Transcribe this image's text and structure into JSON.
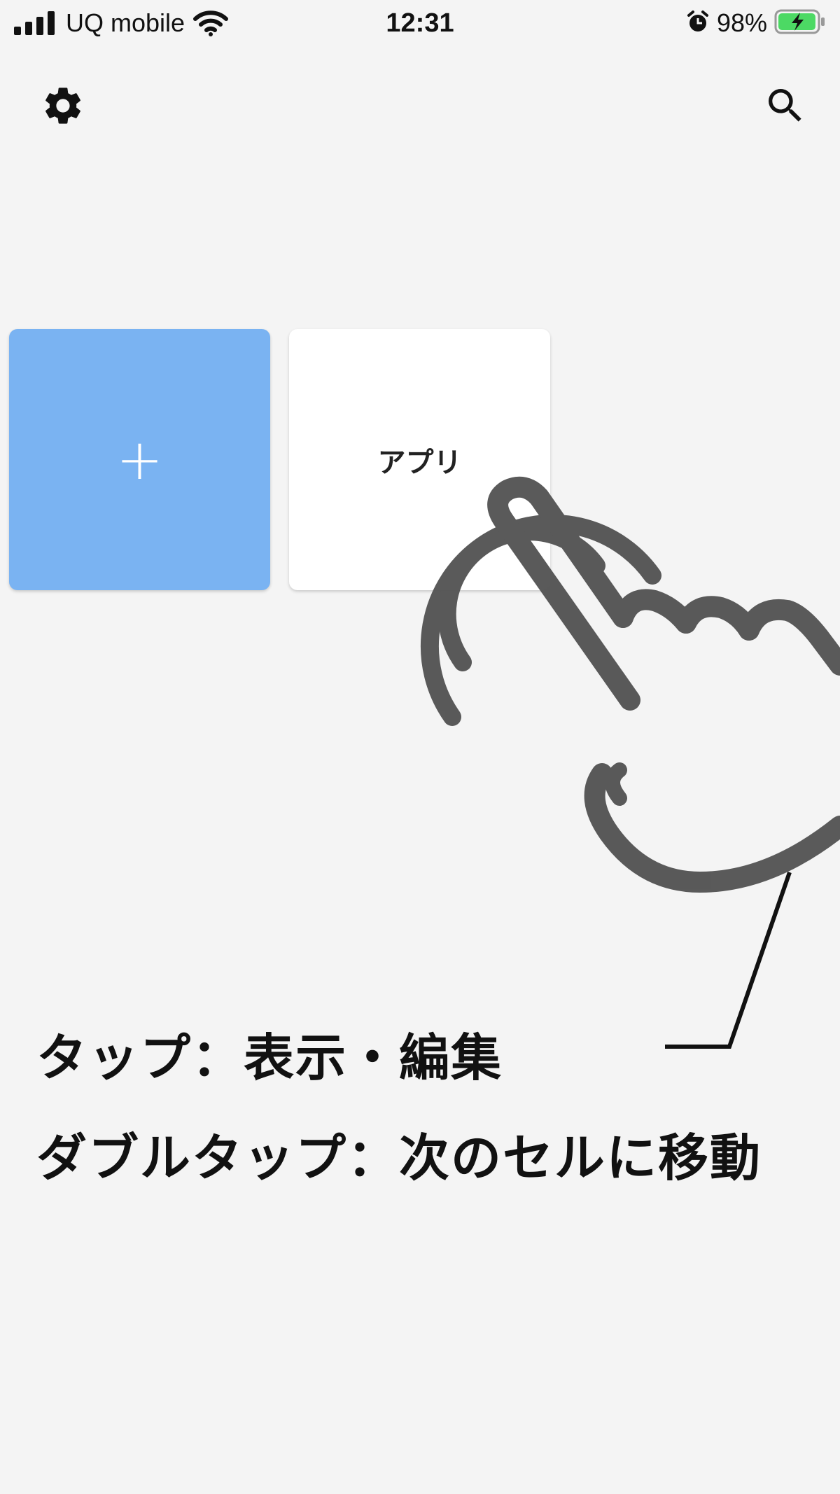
{
  "status_bar": {
    "carrier": "UQ mobile",
    "time": "12:31",
    "battery_percent": "98%",
    "battery_level": 0.98,
    "signal_bars": 4,
    "icons": [
      "signal-icon",
      "wifi-icon",
      "alarm-icon",
      "battery-charging-icon"
    ]
  },
  "toolbar": {
    "left_icon": "gear-icon",
    "right_icon": "search-icon"
  },
  "tiles": [
    {
      "kind": "add",
      "label": "+",
      "color": "#7ab3f2"
    },
    {
      "kind": "app",
      "label": "アプリ",
      "color": "#ffffff"
    }
  ],
  "annotation": {
    "gesture_icon": "double-tap-hand-icon",
    "line1": "タップ：表示・編集",
    "line2": "ダブルタップ：次のセルに移動"
  },
  "colors": {
    "background": "#f4f4f4",
    "accent_tile": "#7ab3f2",
    "hand": "#555555",
    "battery_green": "#4cd964"
  }
}
